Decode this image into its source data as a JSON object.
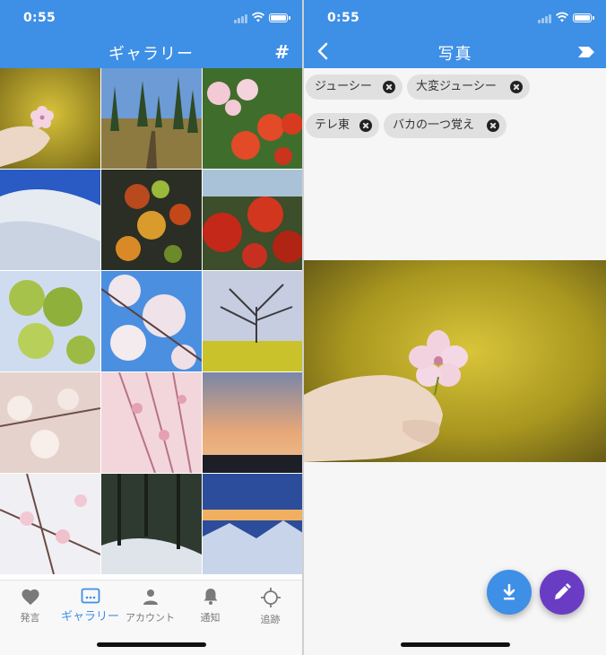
{
  "status": {
    "time": "0:55"
  },
  "gallery": {
    "title": "ギャラリー",
    "hash_icon": "#",
    "tiles": [
      {
        "icon": "flower-photo"
      },
      {
        "icon": "forest-path-photo"
      },
      {
        "icon": "ranunculus-photo"
      },
      {
        "icon": "snow-mountain-photo"
      },
      {
        "icon": "autumn-leaves-photo"
      },
      {
        "icon": "red-azalea-photo"
      },
      {
        "icon": "green-blossom-photo"
      },
      {
        "icon": "cherry-blossom-photo"
      },
      {
        "icon": "bare-tree-photo"
      },
      {
        "icon": "white-plum-photo"
      },
      {
        "icon": "pink-blossom-photo"
      },
      {
        "icon": "sunset-city-photo"
      },
      {
        "icon": "white-blossom-photo"
      },
      {
        "icon": "snowy-forest-photo"
      },
      {
        "icon": "mountain-sunrise-photo"
      }
    ]
  },
  "nav": {
    "items": [
      {
        "label": "発言",
        "icon": "heart-icon"
      },
      {
        "label": "ギャラリー",
        "icon": "gallery-icon",
        "active": true
      },
      {
        "label": "アカウント",
        "icon": "person-icon"
      },
      {
        "label": "通知",
        "icon": "bell-icon"
      },
      {
        "label": "追跡",
        "icon": "crosshair-icon"
      }
    ]
  },
  "detail": {
    "title": "写真",
    "tags": [
      "ジューシー",
      "大変ジューシー",
      "テレ東",
      "バカの一つ覚え"
    ]
  },
  "colors": {
    "appbar": "#3e8fe6",
    "download_fab": "#3e8fe6",
    "edit_fab": "#6a3cc4",
    "chip": "#e0e0e0"
  }
}
